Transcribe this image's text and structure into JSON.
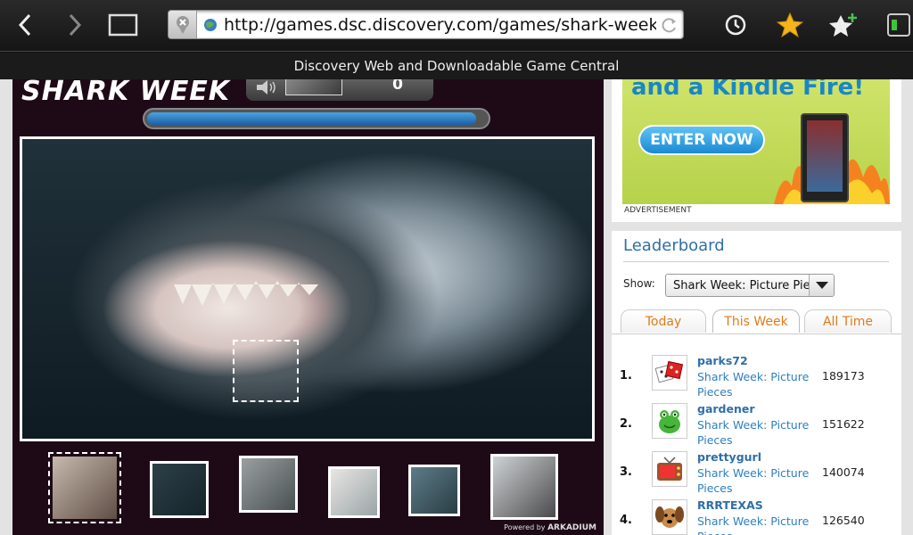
{
  "browser": {
    "url": "http://games.dsc.discovery.com/games/shark-week-pi",
    "page_title": "Discovery Web and Downloadable Game Central"
  },
  "game": {
    "logo_text": "SHARK WEEK",
    "score": "0",
    "progress_fraction": 0.97,
    "powered_by": "Powered by",
    "powered_by_brand": "ARKADIUM"
  },
  "ad": {
    "headline": "and a Kindle Fire!",
    "button_label": "ENTER NOW",
    "label": "ADVERTISEMENT"
  },
  "leaderboard": {
    "title": "Leaderboard",
    "show_label": "Show:",
    "selected_game": "Shark Week: Picture Piec",
    "tabs": [
      {
        "label": "Today",
        "active": false
      },
      {
        "label": "This Week",
        "active": true
      },
      {
        "label": "All Time",
        "active": false
      }
    ],
    "entries": [
      {
        "rank": "1.",
        "user": "parks72",
        "game": "Shark Week: Picture Pieces",
        "score": "189173",
        "avatar": "dice-icon"
      },
      {
        "rank": "2.",
        "user": "gardener",
        "game": "Shark Week: Picture Pieces",
        "score": "151622",
        "avatar": "frog-icon"
      },
      {
        "rank": "3.",
        "user": "prettygurl",
        "game": "Shark Week: Picture Pieces",
        "score": "140074",
        "avatar": "tv-icon"
      },
      {
        "rank": "4.",
        "user": "RRRTEXAS",
        "game": "Shark Week: Picture Pieces",
        "score": "126540",
        "avatar": "dog-icon"
      }
    ]
  },
  "colors": {
    "link_blue": "#2f6fa8",
    "tab_orange": "#e07b18",
    "game_bg": "#1e0a17"
  }
}
